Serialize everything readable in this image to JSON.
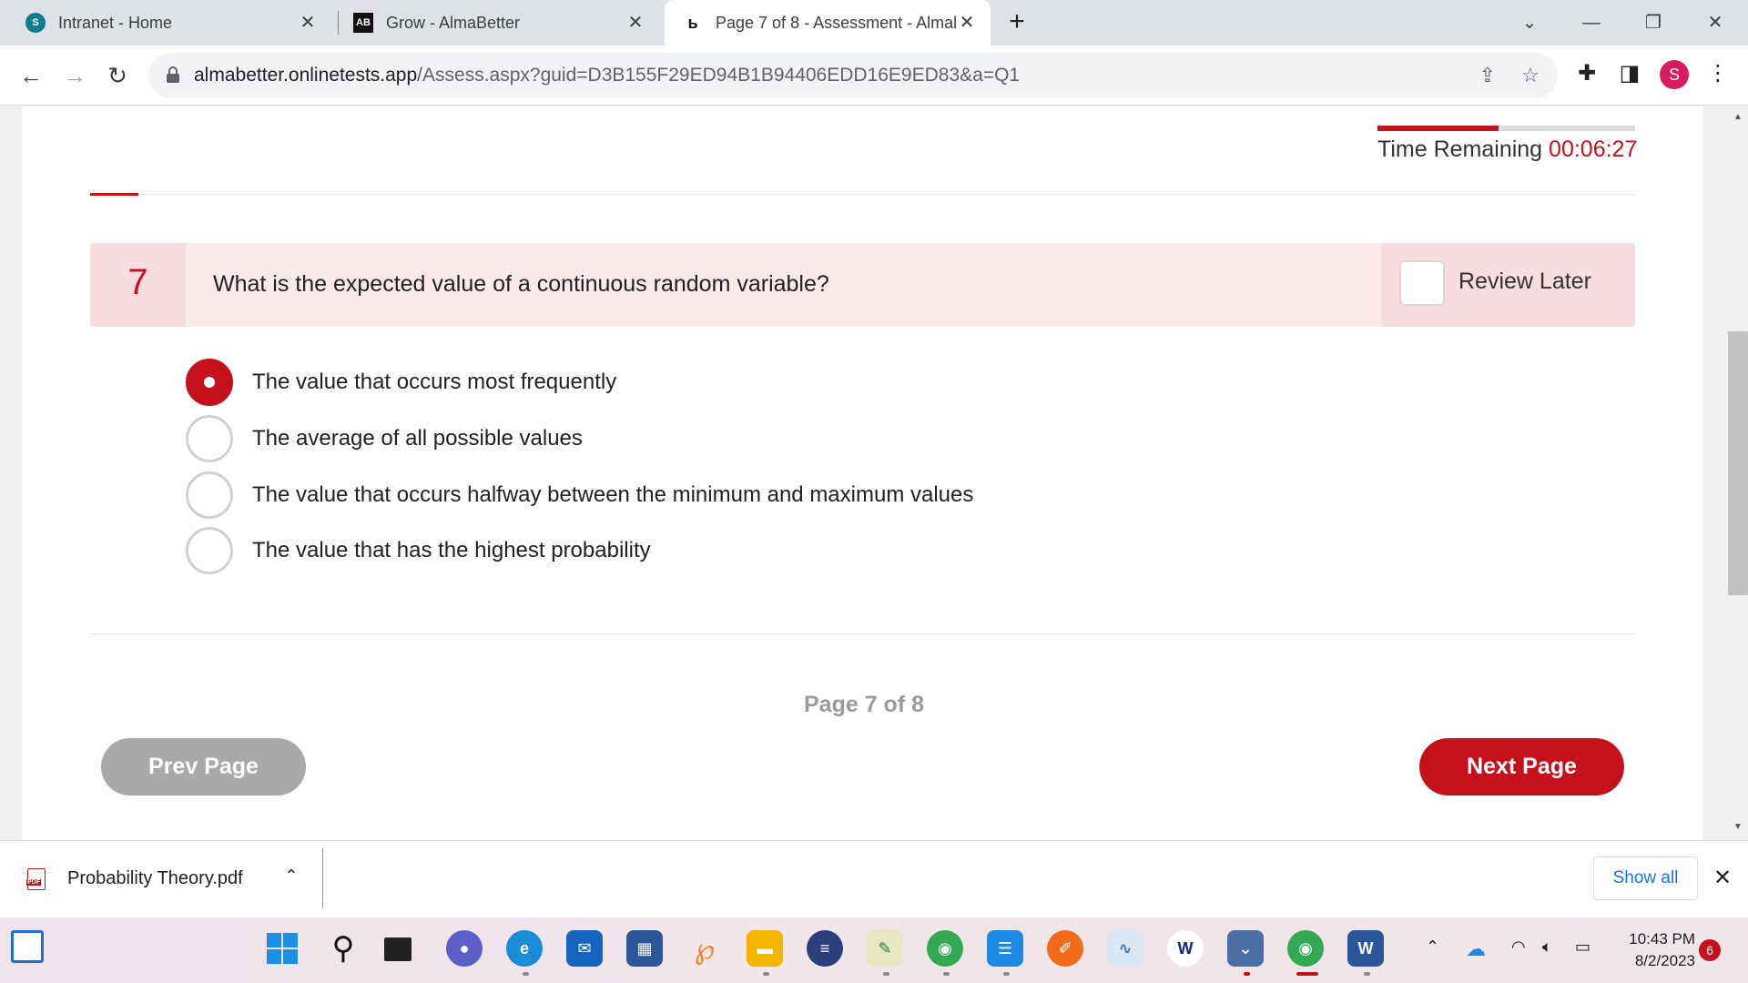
{
  "browser": {
    "tabs": [
      {
        "title": "Intranet - Home",
        "favicon": "sharepoint-icon",
        "active": false
      },
      {
        "title": "Grow - AlmaBetter",
        "favicon": "almabetter-icon",
        "active": false
      },
      {
        "title": "Page 7 of 8 - Assessment - Almal",
        "favicon": "assessment-icon",
        "active": true
      }
    ],
    "new_tab": "+",
    "url_host": "almabetter.onlinetests.app",
    "url_path": "/Assess.aspx?guid=D3B155F29ED94B1B94406EDD16E9ED83&a=Q1",
    "profile_initial": "S"
  },
  "timer": {
    "label": "Time Remaining",
    "value": "00:06:27",
    "fraction_elapsed": 0.47
  },
  "question": {
    "number": "7",
    "text": "What is the expected value of a continuous random variable?",
    "review_label": "Review Later",
    "review_checked": false,
    "options": [
      {
        "label": "The value that occurs most frequently",
        "selected": true
      },
      {
        "label": "The average of all possible values",
        "selected": false
      },
      {
        "label": "The value that occurs halfway between the minimum and maximum values",
        "selected": false
      },
      {
        "label": "The value that has the highest probability",
        "selected": false
      }
    ]
  },
  "pagination": {
    "indicator": "Page 7 of 8",
    "prev_label": "Prev Page",
    "next_label": "Next Page"
  },
  "downloads": {
    "file_name": "Probability Theory.pdf",
    "file_badge": "PDF",
    "show_all_label": "Show all"
  },
  "taskbar": {
    "time": "10:43 PM",
    "date": "8/2/2023",
    "notification_count": "6"
  },
  "colors": {
    "accent": "#c4111c",
    "question_bg": "#fbeaea",
    "prev_button": "#a9a9a9"
  }
}
